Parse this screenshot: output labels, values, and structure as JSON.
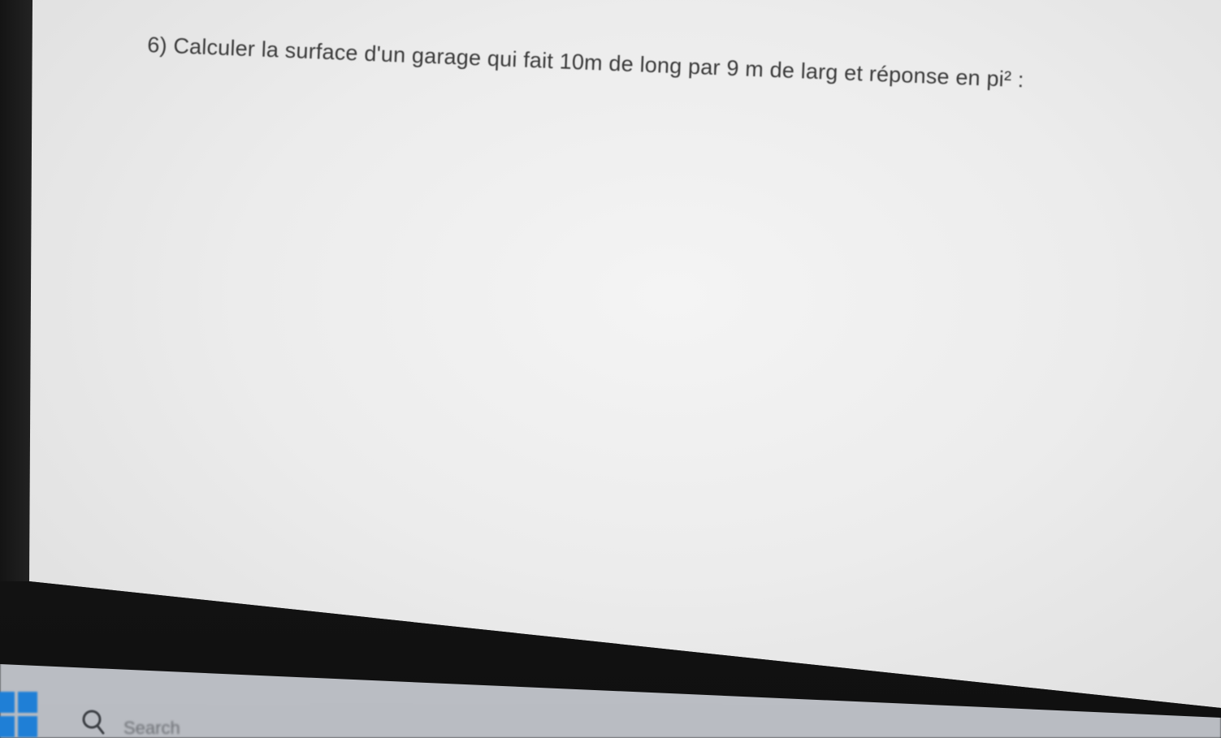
{
  "document": {
    "question": "6) Calculer la surface d'un garage qui fait 10m de long par 9 m de larg et réponse en pi² :"
  },
  "taskbar": {
    "start_icon": "windows-start-icon",
    "search_icon": "search-icon",
    "search_placeholder": "Search"
  },
  "colors": {
    "page": "#ececec",
    "bezel": "#1b1b1b",
    "taskbar": "#c4c7cd",
    "start_blue": "#1f7fd6"
  }
}
